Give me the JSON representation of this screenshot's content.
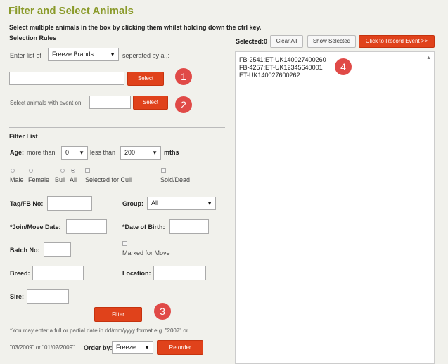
{
  "header": {
    "title": "Filter and Select Animals",
    "instruction": "Select multiple animals in the box by clicking them whilst holding down the ctrl key.",
    "selection_rules": "Selection Rules"
  },
  "rules": {
    "enter_list_prefix": "Enter list of",
    "list_type_value": "Freeze Brands",
    "separated_by": "seperated by a ,:",
    "select_button": "Select",
    "event_label": "Select animals with event on:",
    "event_select_button": "Select"
  },
  "selection": {
    "selected_label": "Selected:0",
    "clear_all": "Clear All",
    "show_selected": "Show Selected",
    "record_event": "Click to Record Event >>",
    "items": [
      "FB-2541:ET-UK140027400260",
      "FB-4257:ET-UK12345640001",
      "ET-UK140027600262"
    ]
  },
  "filter": {
    "heading": "Filter List",
    "age_label": "Age:",
    "more_than": "more than",
    "more_than_value": "0",
    "less_than": "less than",
    "less_than_value": "200",
    "mths": "mths",
    "radios": [
      "Male",
      "Female",
      "Bull",
      "All"
    ],
    "selected_radio": "All",
    "selected_for_cull": "Selected for Cull",
    "sold_dead": "Sold/Dead",
    "tag_label": "Tag/FB No:",
    "group_label": "Group:",
    "group_value": "All",
    "join_label": "*Join/Move Date:",
    "dob_label": "*Date of Birth:",
    "batch_label": "Batch No:",
    "marked_for_move": "Marked for Move",
    "breed_label": "Breed:",
    "location_label": "Location:",
    "sire_label": "Sire:",
    "filter_button": "Filter",
    "note_line1": "*You may enter a full or partial date in dd/mm/yyyy format e.g. \"2007\" or",
    "note_line2": "\"03/2009\" or \"01/02/2009\"",
    "order_by": "Order by:",
    "order_value": "Freeze",
    "reorder_button": "Re order"
  },
  "badges": [
    "1",
    "2",
    "3",
    "4"
  ],
  "colors": {
    "title": "#8a9a2a",
    "accent_button": "#e0421b",
    "badge": "#e04a47",
    "background": "#f1f1ec"
  }
}
